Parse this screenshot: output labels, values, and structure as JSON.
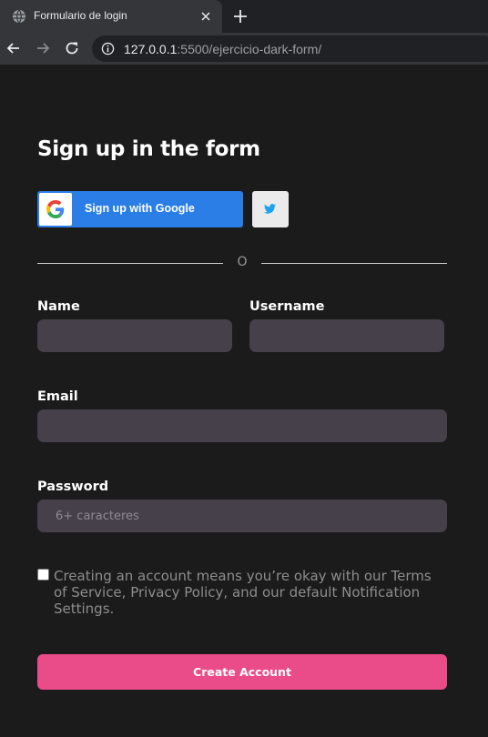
{
  "browser": {
    "tab_title": "Formulario de login",
    "url_host": "127.0.0.1",
    "url_rest": ":5500/ejercicio-dark-form/"
  },
  "form": {
    "title": "Sign up in the form",
    "google_button_label": "Sign up with Google",
    "divider_text": "O",
    "name_label": "Name",
    "name_value": "",
    "username_label": "Username",
    "username_value": "",
    "email_label": "Email",
    "email_value": "",
    "password_label": "Password",
    "password_value": "",
    "password_placeholder": "6+ caracteres",
    "terms_text": "Creating an account means you’re okay with our Terms of Service, Privacy Policy, and our default Notification Settings.",
    "terms_checked": false,
    "submit_label": "Create Account"
  },
  "colors": {
    "page_background": "#1b1b1b",
    "input_background": "#45404a",
    "google_blue": "#2a7ee6",
    "accent_pink": "#ea4c89",
    "twitter_blue": "#1da1f2"
  },
  "icons": [
    "globe-icon",
    "close-icon",
    "plus-icon",
    "back-arrow-icon",
    "forward-arrow-icon",
    "reload-icon",
    "info-icon",
    "google-logo-icon",
    "twitter-icon"
  ]
}
